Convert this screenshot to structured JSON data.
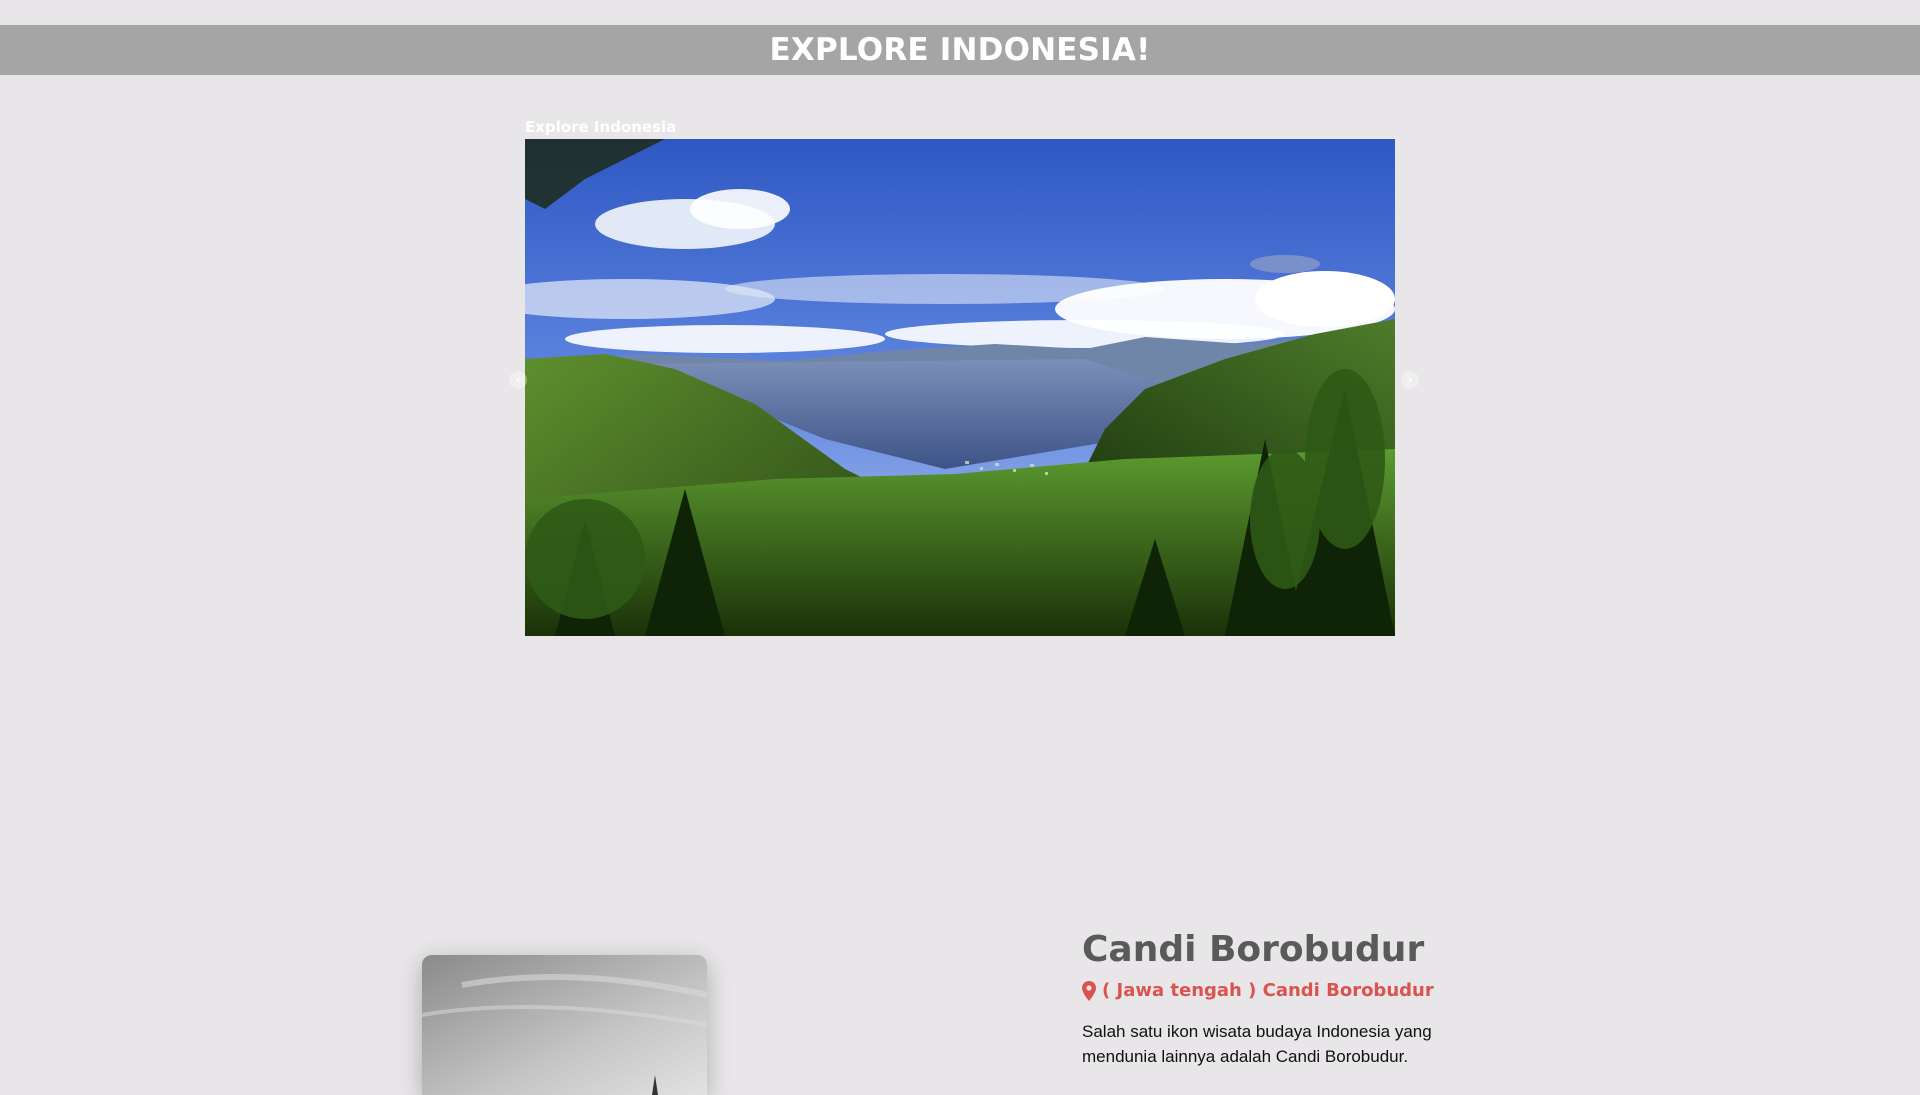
{
  "header": {
    "title": "EXPLORE INDONESIA!"
  },
  "carousel": {
    "caption": "Explore Indonesia",
    "prev_icon": "chevron-left-icon",
    "next_icon": "chevron-right-icon"
  },
  "destination": {
    "title": "Candi Borobudur",
    "location_icon": "map-pin-icon",
    "location": "( Jawa tengah ) Candi Borobudur",
    "description": "Salah satu ikon wisata budaya Indonesia yang mendunia lainnya adalah Candi Borobudur."
  },
  "colors": {
    "background": "#e8e6e8",
    "header_bar": "#a5a5a5",
    "accent_red": "#d9534f",
    "title_gray": "#5a5a5a"
  }
}
